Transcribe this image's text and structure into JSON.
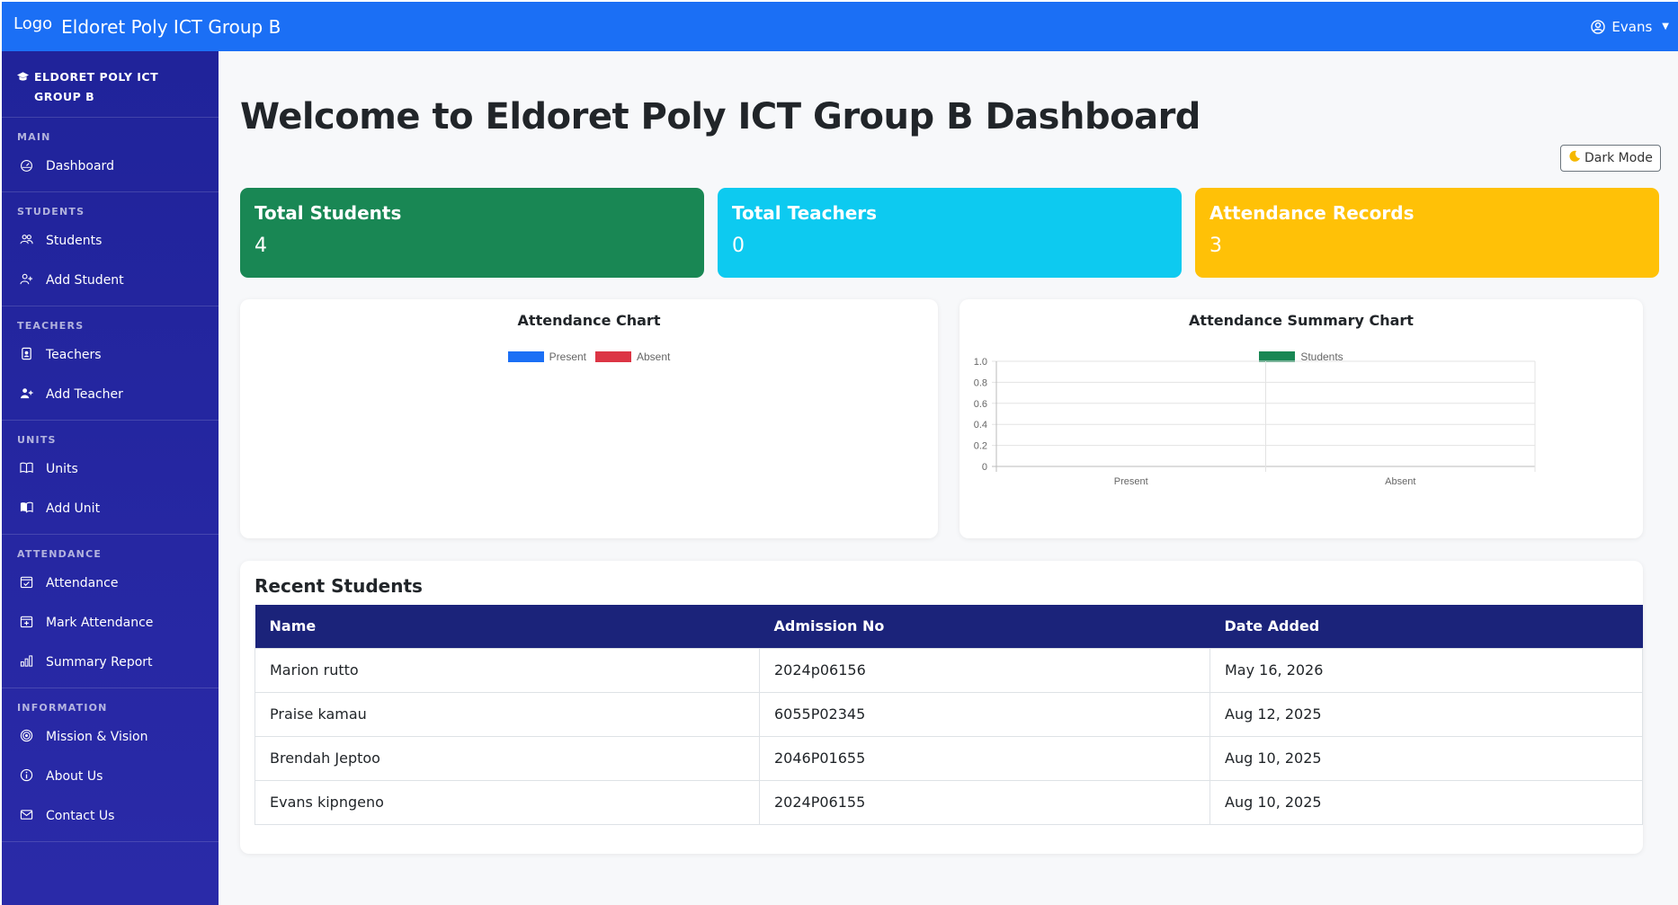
{
  "topbar": {
    "logo": "Logo",
    "brand": "Eldoret Poly ICT Group B",
    "user": "Evans"
  },
  "sidebar": {
    "title": "ELDORET POLY ICT GROUP B",
    "sections": [
      {
        "heading": "MAIN",
        "items": [
          {
            "label": "Dashboard",
            "icon": "speedometer-icon"
          }
        ]
      },
      {
        "heading": "STUDENTS",
        "items": [
          {
            "label": "Students",
            "icon": "people-icon"
          },
          {
            "label": "Add Student",
            "icon": "person-add-icon"
          }
        ]
      },
      {
        "heading": "TEACHERS",
        "items": [
          {
            "label": "Teachers",
            "icon": "badge-icon"
          },
          {
            "label": "Add Teacher",
            "icon": "person-plus-icon"
          }
        ]
      },
      {
        "heading": "UNITS",
        "items": [
          {
            "label": "Units",
            "icon": "book-icon"
          },
          {
            "label": "Add Unit",
            "icon": "book-fill-icon"
          }
        ]
      },
      {
        "heading": "ATTENDANCE",
        "items": [
          {
            "label": "Attendance",
            "icon": "calendar-check-icon"
          },
          {
            "label": "Mark Attendance",
            "icon": "calendar-plus-icon"
          },
          {
            "label": "Summary Report",
            "icon": "bar-chart-icon"
          }
        ]
      },
      {
        "heading": "INFORMATION",
        "items": [
          {
            "label": "Mission & Vision",
            "icon": "target-icon"
          },
          {
            "label": "About Us",
            "icon": "info-icon"
          },
          {
            "label": "Contact Us",
            "icon": "envelope-icon"
          }
        ]
      }
    ]
  },
  "main": {
    "title": "Welcome to Eldoret Poly ICT Group B Dashboard",
    "dark_mode": "Dark Mode",
    "stats": [
      {
        "label": "Total Students",
        "value": "4",
        "color": "#198754"
      },
      {
        "label": "Total Teachers",
        "value": "0",
        "color": "#0dcaf0"
      },
      {
        "label": "Attendance Records",
        "value": "3",
        "color": "#ffc107"
      }
    ]
  },
  "chart_data": [
    {
      "type": "bar",
      "title": "Attendance Chart",
      "series": [
        {
          "name": "Present",
          "color": "#1b6ff5",
          "values": []
        },
        {
          "name": "Absent",
          "color": "#dc3545",
          "values": []
        }
      ],
      "categories": []
    },
    {
      "type": "bar",
      "title": "Attendance Summary Chart",
      "categories": [
        "Present",
        "Absent"
      ],
      "series": [
        {
          "name": "Students",
          "color": "#198754",
          "values": [
            0,
            0
          ]
        }
      ],
      "ylim": [
        0,
        1.0
      ],
      "yticks": [
        "1.0",
        "0.8",
        "0.6",
        "0.4",
        "0.2",
        "0"
      ],
      "grid": true,
      "legend": "top"
    }
  ],
  "recent": {
    "title": "Recent Students",
    "columns": [
      "Name",
      "Admission No",
      "Date Added"
    ],
    "rows": [
      [
        "Marion rutto",
        "2024p06156",
        "May 16, 2026"
      ],
      [
        "Praise kamau",
        "6055P02345",
        "Aug 12, 2025"
      ],
      [
        "Brendah Jeptoo",
        "2046P01655",
        "Aug 10, 2025"
      ],
      [
        "Evans kipngeno",
        "2024P06155",
        "Aug 10, 2025"
      ]
    ]
  }
}
